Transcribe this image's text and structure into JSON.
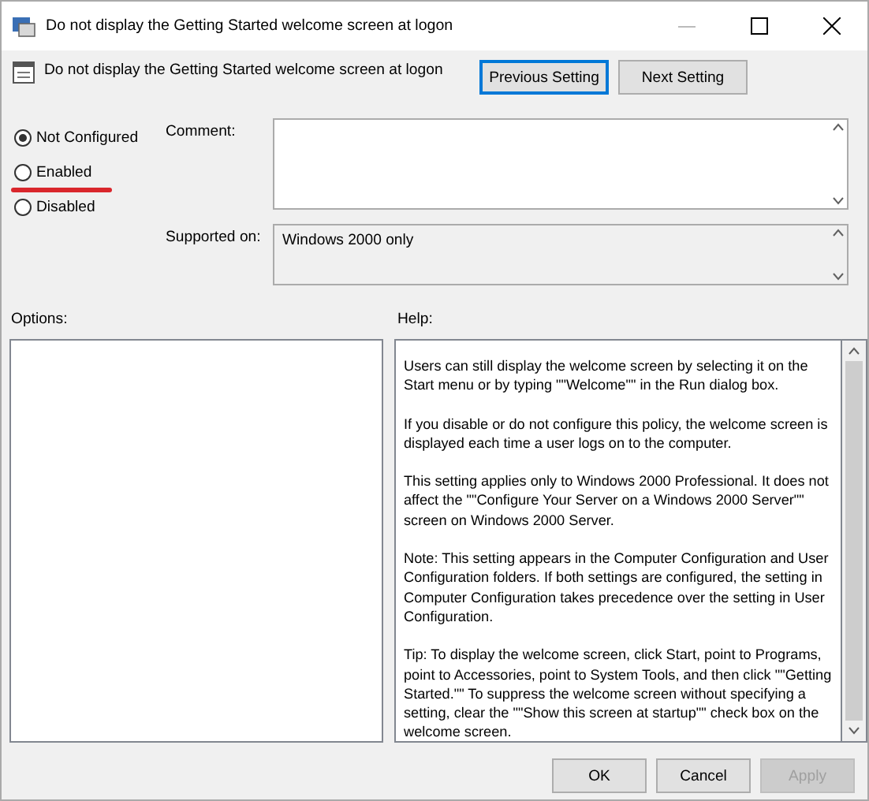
{
  "window": {
    "title": "Do not display the Getting Started welcome screen at logon"
  },
  "header": {
    "setting_title": "Do not display the Getting Started welcome screen at logon",
    "buttons": [
      {
        "label": "Previous Setting",
        "focused": true
      },
      {
        "label": "Next Setting",
        "focused": false
      }
    ]
  },
  "states": [
    {
      "label": "Not Configured",
      "selected": true
    },
    {
      "label": "Enabled",
      "selected": false
    },
    {
      "label": "Disabled",
      "selected": false
    }
  ],
  "comment": {
    "label": "Comment:"
  },
  "supported_on": {
    "label": "Supported on:",
    "value": "Windows 2000 only"
  },
  "options": {
    "label": "Options:"
  },
  "help": {
    "label": "Help:",
    "paragraphs": [
      "Users can still display the welcome screen by selecting it on the Start menu or by typing \"\"Welcome\"\" in the Run dialog box.",
      "If you disable or do not configure this policy, the welcome screen is displayed each time a user logs on to the computer.",
      "This setting applies only to Windows 2000 Professional. It does not affect the \"\"Configure Your Server on a Windows 2000 Server\"\" screen on Windows 2000 Server.",
      "Note: This setting appears in the Computer Configuration and User Configuration folders. If both settings are configured, the setting in Computer Configuration takes precedence over the setting in User Configuration.",
      "Tip: To display the welcome screen, click Start, point to Programs, point to Accessories, point to System Tools, and then click \"\"Getting Started.\"\" To suppress the welcome screen without specifying a setting, clear the \"\"Show this screen at startup\"\" check box on the welcome screen."
    ]
  },
  "footer": {
    "buttons": [
      {
        "label": "OK",
        "disabled": false
      },
      {
        "label": "Cancel",
        "disabled": false
      },
      {
        "label": "Apply",
        "disabled": true
      }
    ]
  }
}
